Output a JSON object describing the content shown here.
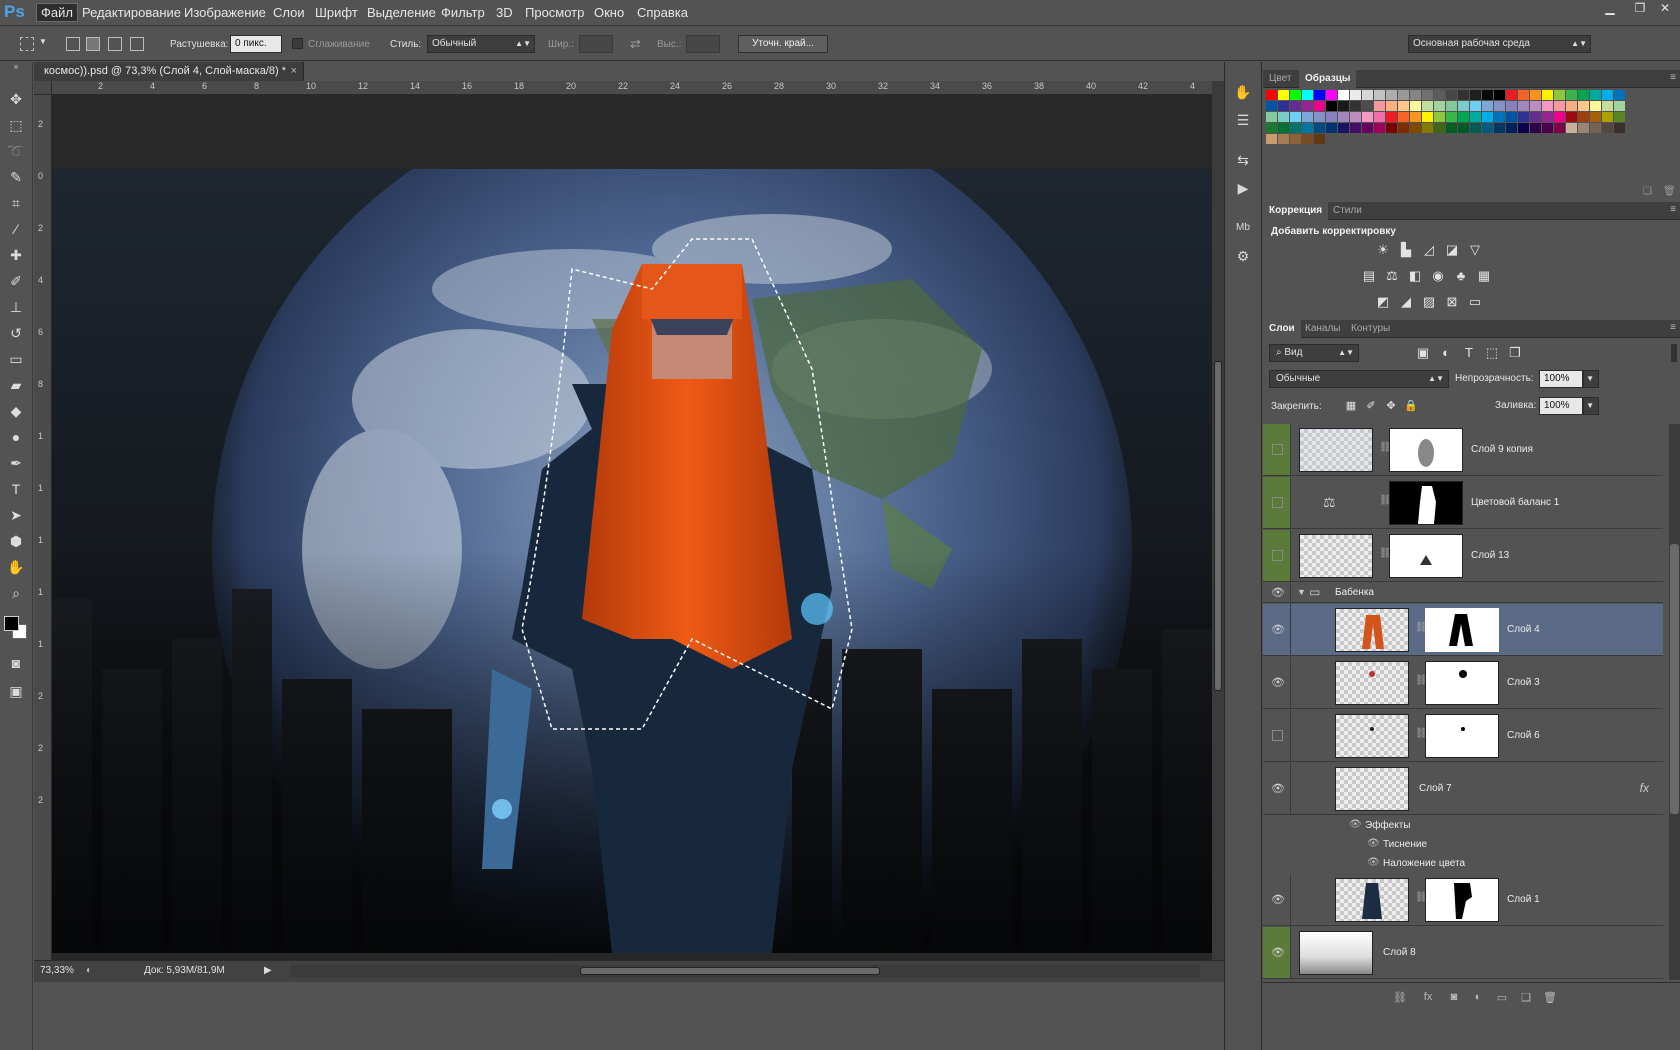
{
  "app": {
    "logo": "Ps",
    "menu": [
      "Файл",
      "Редактирование",
      "Изображение",
      "Слои",
      "Шрифт",
      "Выделение",
      "Фильтр",
      "3D",
      "Просмотр",
      "Окно",
      "Справка"
    ],
    "window_controls": [
      "minimize-icon",
      "restore-icon",
      "close-icon"
    ]
  },
  "options_bar": {
    "feather_label": "Растушевка:",
    "feather_value": "0 пикс.",
    "antialias_label": "Сглаживание",
    "style_label": "Стиль:",
    "style_value": "Обычный",
    "width_label": "Шир.:",
    "height_label": "Выс.:",
    "refine_button": "Уточн. край...",
    "workspace_value": "Основная рабочая среда"
  },
  "document": {
    "tab_title": "космос)).psd @ 73,3% (Слой 4, Слой-маска/8) *",
    "ruler_top": [
      "2",
      "4",
      "6",
      "8",
      "10",
      "12",
      "14",
      "16",
      "18",
      "20",
      "22",
      "24",
      "26",
      "28",
      "30",
      "32",
      "34",
      "36",
      "38",
      "40",
      "42",
      "4"
    ],
    "ruler_left": [
      "2",
      "0",
      "2",
      "4",
      "6",
      "8",
      "1",
      "1",
      "1",
      "1",
      "1",
      "2",
      "2",
      "2"
    ],
    "zoom": "73,33%",
    "doc_info": "Док: 5,93M/81,9M"
  },
  "tools": [
    "move-tool-icon",
    "marquee-tool-icon",
    "lasso-tool-icon",
    "quick-select-tool-icon",
    "crop-tool-icon",
    "eyedropper-tool-icon",
    "healing-tool-icon",
    "brush-tool-icon",
    "stamp-tool-icon",
    "history-brush-tool-icon",
    "eraser-tool-icon",
    "gradient-tool-icon",
    "blur-tool-icon",
    "dodge-tool-icon",
    "pen-tool-icon",
    "type-tool-icon",
    "path-select-tool-icon",
    "shape-tool-icon",
    "hand-tool-icon",
    "zoom-tool-icon"
  ],
  "colors": {
    "foreground": "#000000",
    "background": "#ffffff",
    "panel_bg": "#535353",
    "selected_layer": "#5b6a85",
    "visibility_green": "#5a7b3a"
  },
  "swatches_panel": {
    "tabs": [
      "Цвет",
      "Образцы"
    ],
    "active_tab": "Образцы",
    "swatches": [
      "#ff0000",
      "#ffff00",
      "#00ff00",
      "#00ffff",
      "#0000ff",
      "#ff00ff",
      "#ffffff",
      "#ebebeb",
      "#d6d6d6",
      "#c2c2c2",
      "#adadad",
      "#999999",
      "#858585",
      "#707070",
      "#5c5c5c",
      "#474747",
      "#333333",
      "#1f1f1f",
      "#0a0a0a",
      "#000000",
      "#ed1c24",
      "#f26522",
      "#f7941d",
      "#fff200",
      "#8dc63f",
      "#39b54a",
      "#00a651",
      "#00a99d",
      "#00aeef",
      "#0072bc",
      "#0054a6",
      "#2e3192",
      "#662d91",
      "#92278f",
      "#ec008c",
      "#000000",
      "#1a1a1a",
      "#333333",
      "#4d4d4d",
      "#f5989d",
      "#f9ad81",
      "#fdc68a",
      "#fff799",
      "#c4df9b",
      "#a3d39c",
      "#82ca9c",
      "#7accc8",
      "#6dcff6",
      "#7da7d9",
      "#8393ca",
      "#8781bd",
      "#a187be",
      "#bc8dbf",
      "#f49ac2",
      "#f6989d",
      "#f9ad81",
      "#fdc68a",
      "#fff799",
      "#c4df9b",
      "#a3d39c",
      "#82ca9c",
      "#7accc8",
      "#6dcff6",
      "#7da7d9",
      "#8393ca",
      "#8781bd",
      "#a187be",
      "#bc8dbf",
      "#f49ac2",
      "#f06eaa",
      "#ed1c24",
      "#f26522",
      "#f7941d",
      "#fff200",
      "#8dc63f",
      "#39b54a",
      "#00a651",
      "#00a99d",
      "#00aeef",
      "#0072bc",
      "#0054a6",
      "#2e3192",
      "#662d91",
      "#92278f",
      "#ec008c",
      "#9e0b0f",
      "#a0410d",
      "#a36209",
      "#aba000",
      "#598527",
      "#1a7b30",
      "#007236",
      "#00746b",
      "#0076a3",
      "#004b80",
      "#003471",
      "#1b1464",
      "#440e62",
      "#630460",
      "#9e005d",
      "#790000",
      "#7b2e00",
      "#7d4900",
      "#827b00",
      "#406618",
      "#005e20",
      "#005826",
      "#005952",
      "#005b7f",
      "#003663",
      "#002157",
      "#0d004c",
      "#32004b",
      "#4b0049",
      "#7b0046",
      "#c7b299",
      "#998675",
      "#736357",
      "#534741",
      "#37302d",
      "#c69c6d",
      "#a67c52",
      "#8c6239",
      "#754c24",
      "#603913"
    ]
  },
  "adjustments_panel": {
    "tabs": [
      "Коррекция",
      "Стили"
    ],
    "active_tab": "Коррекция",
    "title": "Добавить корректировку",
    "row1": [
      "brightness-icon",
      "levels-icon",
      "curves-icon",
      "exposure-icon",
      "vibrance-icon"
    ],
    "row2": [
      "hue-saturation-icon",
      "color-balance-icon",
      "black-white-icon",
      "photo-filter-icon",
      "channel-mixer-icon",
      "color-lookup-icon"
    ],
    "row3": [
      "invert-icon",
      "posterize-icon",
      "threshold-icon",
      "selective-color-icon",
      "gradient-map-icon"
    ]
  },
  "layers_panel": {
    "tabs": [
      "Слои",
      "Каналы",
      "Контуры"
    ],
    "active_tab": "Слои",
    "filter_value": "Вид",
    "blend_mode": "Обычные",
    "opacity_label": "Непрозрачность:",
    "opacity_value": "100%",
    "lock_label": "Закрепить:",
    "fill_label": "Заливка:",
    "fill_value": "100%",
    "layers": [
      {
        "name": "Слой 9 копия",
        "visible": false,
        "indent": 0,
        "has_mask": true,
        "mask_dark": false,
        "adjustment": false
      },
      {
        "name": "Цветовой баланс 1",
        "visible": false,
        "indent": 0,
        "has_mask": true,
        "mask_dark": true,
        "adjustment": true
      },
      {
        "name": "Слой 13",
        "visible": false,
        "indent": 0,
        "has_mask": true,
        "mask_dark": false,
        "adjustment": false
      }
    ],
    "group": {
      "name": "Бабенка",
      "visible": true
    },
    "group_layers": [
      {
        "name": "Слой 4",
        "visible": true,
        "has_mask": true,
        "selected": true
      },
      {
        "name": "Слой 3",
        "visible": true,
        "has_mask": true,
        "selected": false
      },
      {
        "name": "Слой 6",
        "visible": false,
        "has_mask": true,
        "selected": false
      },
      {
        "name": "Слой 7",
        "visible": true,
        "has_mask": false,
        "selected": false,
        "fx": "fx"
      }
    ],
    "effects_label": "Эффекты",
    "effects": [
      "Тиснение",
      "Наложение цвета"
    ],
    "after_effects_layers": [
      {
        "name": "Слой 1",
        "visible": true,
        "has_mask": true
      }
    ],
    "bottom_layer": {
      "name": "Слой 8",
      "visible": true
    }
  }
}
